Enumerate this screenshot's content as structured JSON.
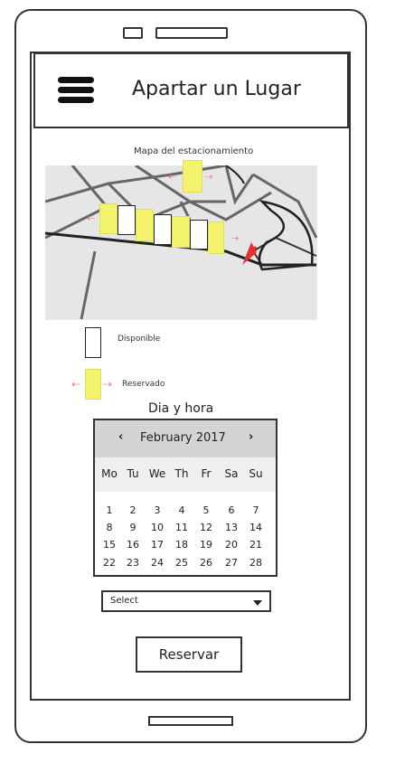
{
  "app": {
    "title": "Apartar un Lugar"
  },
  "map": {
    "label": "Mapa del estacionamiento"
  },
  "legend": {
    "available": "Disponible",
    "reserved": "Reservado"
  },
  "section": {
    "date_time": "Dia y hora"
  },
  "calendar": {
    "month_label": "February 2017",
    "prev": "‹",
    "next": "›",
    "weekdays": [
      "Mo",
      "Tu",
      "We",
      "Th",
      "Fr",
      "Sa",
      "Su"
    ],
    "days": [
      "1",
      "2",
      "3",
      "4",
      "5",
      "6",
      "7",
      "8",
      "9",
      "10",
      "11",
      "12",
      "13",
      "14",
      "15",
      "16",
      "17",
      "18",
      "19",
      "20",
      "21",
      "22",
      "23",
      "24",
      "25",
      "26",
      "27",
      "28"
    ]
  },
  "select": {
    "value": "Select"
  },
  "buttons": {
    "reserve": "Reservar"
  },
  "icons": {
    "menu": "hamburger-icon",
    "dropdown": "caret-down-icon",
    "pointer": "red-arrow-icon"
  },
  "colors": {
    "reserved": "#f3f36d",
    "arrow": "#e53030",
    "map_bg": "#e6e6e6"
  }
}
